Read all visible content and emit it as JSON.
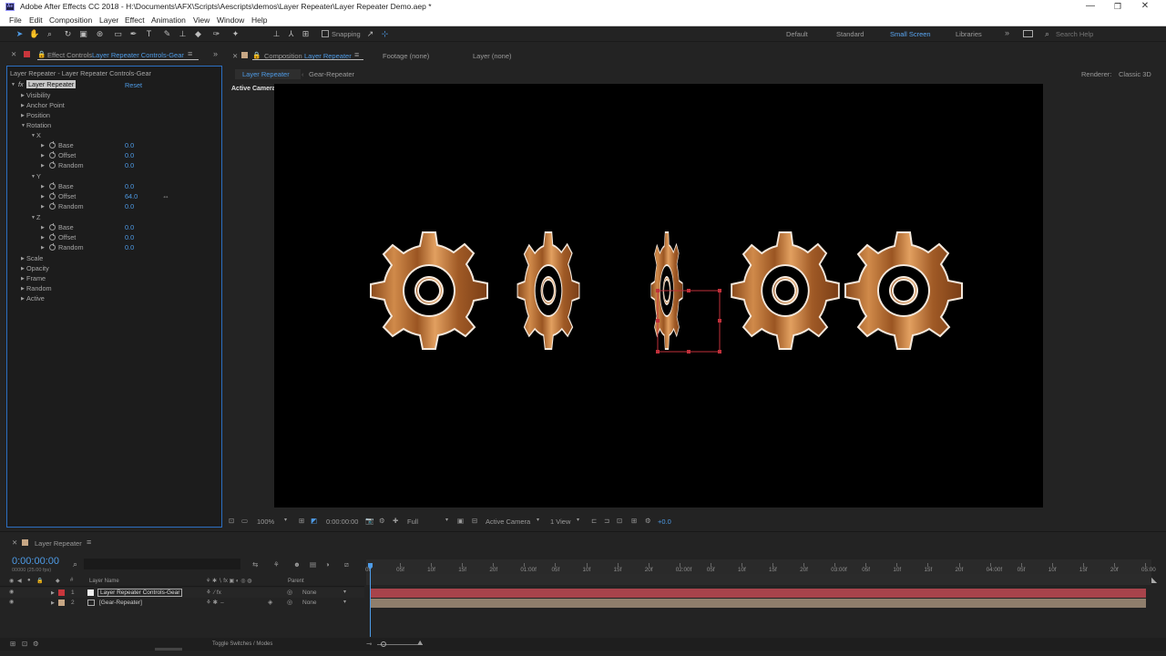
{
  "window": {
    "title": "Adobe After Effects CC 2018 - H:\\Documents\\AFX\\Scripts\\Aescripts\\demos\\Layer Repeater\\Layer Repeater Demo.aep *",
    "logo": "Ae",
    "minimize": "—",
    "restore": "❐",
    "close": "✕"
  },
  "menu": [
    "File",
    "Edit",
    "Composition",
    "Layer",
    "Effect",
    "Animation",
    "View",
    "Window",
    "Help"
  ],
  "toolbar": {
    "snapping_label": "Snapping",
    "workspaces": [
      "Default",
      "Standard",
      "Small Screen",
      "Libraries"
    ],
    "active_workspace": "Small Screen",
    "more": "»",
    "search_placeholder": "Search Help"
  },
  "effect_controls": {
    "tab_prefix": "Effect Controls",
    "tab_layer": "Layer Repeater Controls-Gear",
    "menu_icon": "≡",
    "expand": "»",
    "breadcrumb": "Layer Repeater - Layer Repeater Controls-Gear",
    "fx_label": "fx",
    "effect_name": "Layer Repeater",
    "reset_label": "Reset",
    "properties": {
      "visibility": "Visibility",
      "anchor_point": "Anchor Point",
      "position": "Position",
      "rotation": "Rotation",
      "x": "X",
      "y": "Y",
      "z": "Z",
      "scale": "Scale",
      "opacity": "Opacity",
      "frame": "Frame",
      "random": "Random",
      "active": "Active"
    },
    "rotation": {
      "x": [
        {
          "label": "Base",
          "value": "0.0"
        },
        {
          "label": "Offset",
          "value": "0.0"
        },
        {
          "label": "Random",
          "value": "0.0"
        }
      ],
      "y": [
        {
          "label": "Base",
          "value": "0.0"
        },
        {
          "label": "Offset",
          "value": "64.0"
        },
        {
          "label": "Random",
          "value": "0.0"
        }
      ],
      "z": [
        {
          "label": "Base",
          "value": "0.0"
        },
        {
          "label": "Offset",
          "value": "0.0"
        },
        {
          "label": "Random",
          "value": "0.0"
        }
      ]
    }
  },
  "comp_panel": {
    "tab_prefix": "Composition",
    "tab_name": "Layer Repeater",
    "menu_icon": "≡",
    "footage_tab": "Footage (none)",
    "layer_tab": "Layer (none)",
    "flow": [
      "Layer Repeater",
      "Gear-Repeater"
    ],
    "renderer_label": "Renderer:",
    "renderer_value": "Classic 3D",
    "camera_label": "Active Camera"
  },
  "viewer_bar": {
    "zoom": "100%",
    "timecode": "0:00:00:00",
    "resolution": "Full",
    "camera": "Active Camera",
    "views": "1 View",
    "exposure": "+0.0"
  },
  "timeline": {
    "tab": "Layer Repeater",
    "menu_icon": "≡",
    "timecode": "0:00:00:00",
    "frame_info": "00000 (25.00 fps)",
    "col_hash": "#",
    "col_layer_name": "Layer Name",
    "col_parent": "Parent",
    "toggle_label": "Toggle Switches / Modes",
    "ruler": [
      "0f",
      "05f",
      "10f",
      "15f",
      "20f",
      "01:00f",
      "05f",
      "10f",
      "15f",
      "20f",
      "02:00f",
      "05f",
      "10f",
      "15f",
      "20f",
      "03:00f",
      "05f",
      "10f",
      "15f",
      "20f",
      "04:00f",
      "05f",
      "10f",
      "15f",
      "20f",
      "05:00"
    ],
    "layers": [
      {
        "index": "1",
        "name": "Layer Repeater Controls-Gear",
        "parent": "None",
        "color": "#c9363c",
        "bar_color": "#a8434b"
      },
      {
        "index": "2",
        "name": "[Gear-Repeater]",
        "parent": "None",
        "color": "#c7a785",
        "bar_color": "#8f7e6c"
      }
    ]
  },
  "colors": {
    "accent": "#4e9be6",
    "panel_bg": "#1c1c1c",
    "app_bg": "#232323",
    "active_border": "#2c6fc2"
  },
  "icons": {
    "selection": "selection-tool-icon",
    "hand": "hand-tool-icon",
    "zoom": "zoom-tool-icon",
    "search": "search-icon",
    "visibility": "eye-icon",
    "lock": "lock-icon"
  }
}
